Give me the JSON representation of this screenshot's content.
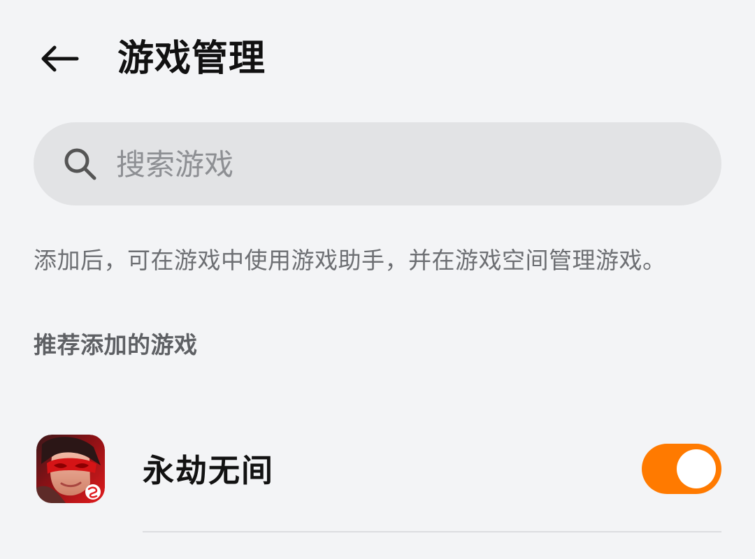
{
  "header": {
    "title": "游戏管理",
    "back_icon": "arrow-left-icon"
  },
  "search": {
    "placeholder": "搜索游戏",
    "icon": "search-icon"
  },
  "hint": "添加后，可在游戏中使用游戏助手，并在游戏空间管理游戏。",
  "recommended": {
    "title": "推荐添加的游戏",
    "games": [
      {
        "name": "永劫无间",
        "icon": "game-avatar-icon",
        "enabled": true
      }
    ]
  },
  "colors": {
    "background": "#f3f4f6",
    "search_background": "#e2e3e5",
    "accent": "#ff7a00"
  }
}
